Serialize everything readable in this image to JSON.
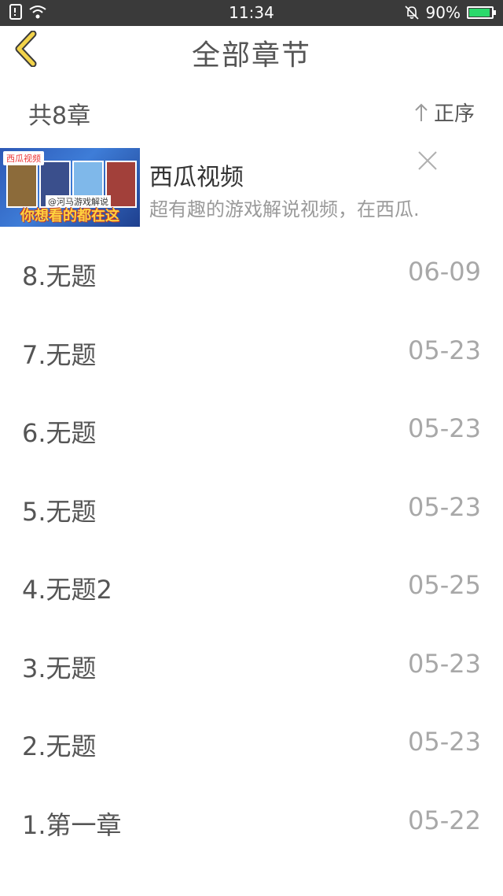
{
  "status_bar": {
    "time": "11:34",
    "battery": "90%"
  },
  "header": {
    "title": "全部章节"
  },
  "subheader": {
    "count": "共8章",
    "order_label": "正序"
  },
  "ad": {
    "thumb_tag": "西瓜视频",
    "thumb_handle": "@河马游戏解说",
    "thumb_banner": "你想看的都在这",
    "name": "西瓜视频",
    "description": "超有趣的游戏解说视频，在西瓜."
  },
  "chapters": [
    {
      "title": "8.无题",
      "date": "06-09"
    },
    {
      "title": "7.无题",
      "date": "05-23"
    },
    {
      "title": "6.无题",
      "date": "05-23"
    },
    {
      "title": "5.无题",
      "date": "05-23"
    },
    {
      "title": "4.无题2",
      "date": "05-25"
    },
    {
      "title": "3.无题",
      "date": "05-23"
    },
    {
      "title": "2.无题",
      "date": "05-23"
    },
    {
      "title": "1.第一章",
      "date": "05-22"
    }
  ],
  "colors": {
    "status_bar_bg": "#3a3a3a",
    "back_arrow": "#f2d34a",
    "battery_fill": "#2bd96b"
  }
}
